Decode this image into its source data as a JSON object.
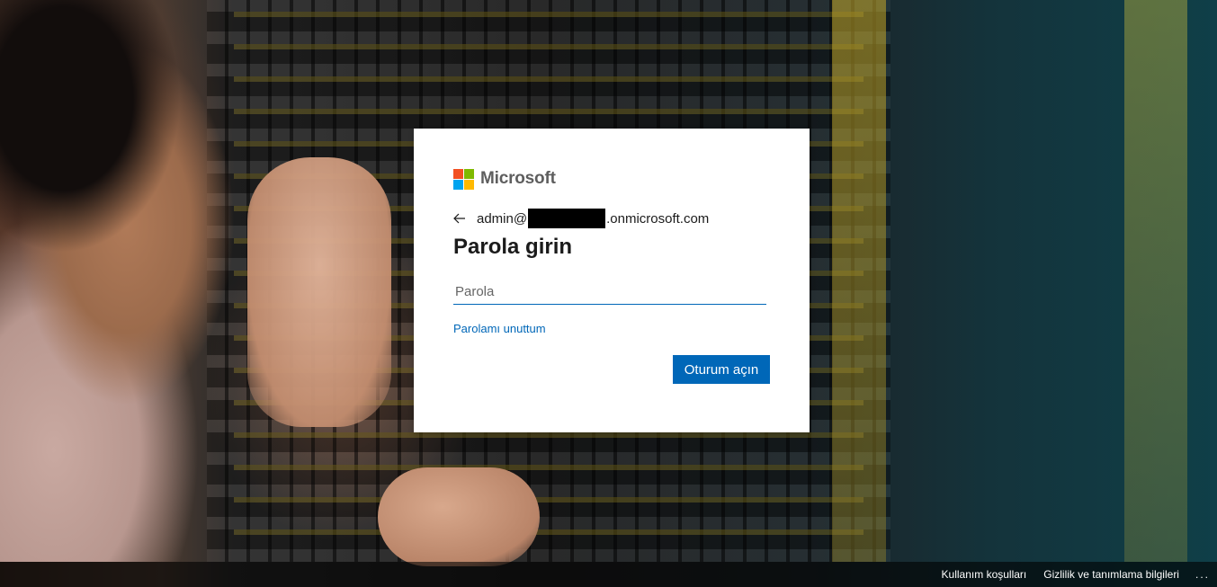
{
  "brand": {
    "name": "Microsoft",
    "colors": {
      "red": "#f25022",
      "green": "#7fba00",
      "blue": "#00a4ef",
      "yellow": "#ffb900",
      "accent": "#0067b8"
    }
  },
  "identity": {
    "back_icon": "arrow-left-icon",
    "prefix": "admin@",
    "suffix": ".onmicrosoft.com"
  },
  "form": {
    "title": "Parola girin",
    "password_placeholder": "Parola",
    "password_value": "",
    "forgot_link": "Parolamı unuttum",
    "signin_button": "Oturum açın"
  },
  "footer": {
    "terms": "Kullanım koşulları",
    "privacy": "Gizlilik ve tanımlama bilgileri",
    "more": "..."
  }
}
